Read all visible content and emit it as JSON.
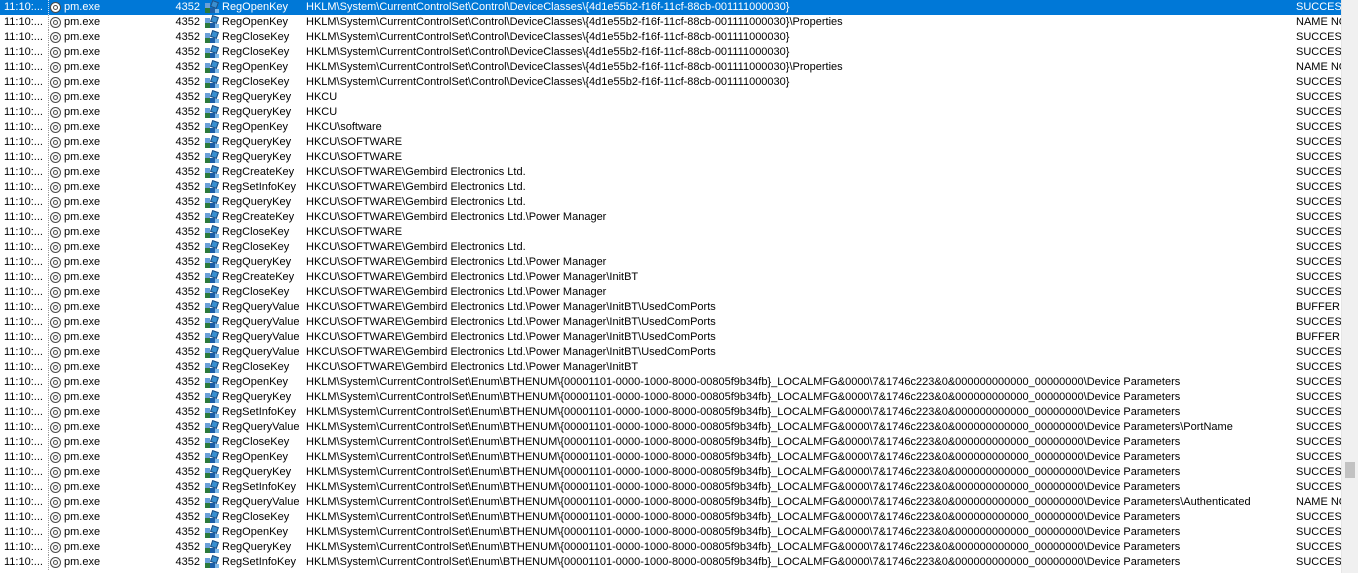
{
  "events": [
    {
      "time": "11:10:...",
      "process": "pm.exe",
      "pid": "4352",
      "operation": "RegOpenKey",
      "path": "HKLM\\System\\CurrentControlSet\\Control\\DeviceClasses\\{4d1e55b2-f16f-11cf-88cb-001111000030}",
      "result": "SUCCESS",
      "selected": true
    },
    {
      "time": "11:10:...",
      "process": "pm.exe",
      "pid": "4352",
      "operation": "RegOpenKey",
      "path": "HKLM\\System\\CurrentControlSet\\Control\\DeviceClasses\\{4d1e55b2-f16f-11cf-88cb-001111000030}\\Properties",
      "result": "NAME NOT FOUND"
    },
    {
      "time": "11:10:...",
      "process": "pm.exe",
      "pid": "4352",
      "operation": "RegCloseKey",
      "path": "HKLM\\System\\CurrentControlSet\\Control\\DeviceClasses\\{4d1e55b2-f16f-11cf-88cb-001111000030}",
      "result": "SUCCESS"
    },
    {
      "time": "11:10:...",
      "process": "pm.exe",
      "pid": "4352",
      "operation": "RegCloseKey",
      "path": "HKLM\\System\\CurrentControlSet\\Control\\DeviceClasses\\{4d1e55b2-f16f-11cf-88cb-001111000030}",
      "result": "SUCCESS"
    },
    {
      "time": "11:10:...",
      "process": "pm.exe",
      "pid": "4352",
      "operation": "RegOpenKey",
      "path": "HKLM\\System\\CurrentControlSet\\Control\\DeviceClasses\\{4d1e55b2-f16f-11cf-88cb-001111000030}\\Properties",
      "result": "NAME NOT FOUND"
    },
    {
      "time": "11:10:...",
      "process": "pm.exe",
      "pid": "4352",
      "operation": "RegCloseKey",
      "path": "HKLM\\System\\CurrentControlSet\\Control\\DeviceClasses\\{4d1e55b2-f16f-11cf-88cb-001111000030}",
      "result": "SUCCESS"
    },
    {
      "time": "11:10:...",
      "process": "pm.exe",
      "pid": "4352",
      "operation": "RegQueryKey",
      "path": "HKCU",
      "result": "SUCCESS"
    },
    {
      "time": "11:10:...",
      "process": "pm.exe",
      "pid": "4352",
      "operation": "RegQueryKey",
      "path": "HKCU",
      "result": "SUCCESS"
    },
    {
      "time": "11:10:...",
      "process": "pm.exe",
      "pid": "4352",
      "operation": "RegOpenKey",
      "path": "HKCU\\software",
      "result": "SUCCESS"
    },
    {
      "time": "11:10:...",
      "process": "pm.exe",
      "pid": "4352",
      "operation": "RegQueryKey",
      "path": "HKCU\\SOFTWARE",
      "result": "SUCCESS"
    },
    {
      "time": "11:10:...",
      "process": "pm.exe",
      "pid": "4352",
      "operation": "RegQueryKey",
      "path": "HKCU\\SOFTWARE",
      "result": "SUCCESS"
    },
    {
      "time": "11:10:...",
      "process": "pm.exe",
      "pid": "4352",
      "operation": "RegCreateKey",
      "path": "HKCU\\SOFTWARE\\Gembird Electronics Ltd.",
      "result": "SUCCESS"
    },
    {
      "time": "11:10:...",
      "process": "pm.exe",
      "pid": "4352",
      "operation": "RegSetInfoKey",
      "path": "HKCU\\SOFTWARE\\Gembird Electronics Ltd.",
      "result": "SUCCESS"
    },
    {
      "time": "11:10:...",
      "process": "pm.exe",
      "pid": "4352",
      "operation": "RegQueryKey",
      "path": "HKCU\\SOFTWARE\\Gembird Electronics Ltd.",
      "result": "SUCCESS"
    },
    {
      "time": "11:10:...",
      "process": "pm.exe",
      "pid": "4352",
      "operation": "RegCreateKey",
      "path": "HKCU\\SOFTWARE\\Gembird Electronics Ltd.\\Power Manager",
      "result": "SUCCESS"
    },
    {
      "time": "11:10:...",
      "process": "pm.exe",
      "pid": "4352",
      "operation": "RegCloseKey",
      "path": "HKCU\\SOFTWARE",
      "result": "SUCCESS"
    },
    {
      "time": "11:10:...",
      "process": "pm.exe",
      "pid": "4352",
      "operation": "RegCloseKey",
      "path": "HKCU\\SOFTWARE\\Gembird Electronics Ltd.",
      "result": "SUCCESS"
    },
    {
      "time": "11:10:...",
      "process": "pm.exe",
      "pid": "4352",
      "operation": "RegQueryKey",
      "path": "HKCU\\SOFTWARE\\Gembird Electronics Ltd.\\Power Manager",
      "result": "SUCCESS"
    },
    {
      "time": "11:10:...",
      "process": "pm.exe",
      "pid": "4352",
      "operation": "RegCreateKey",
      "path": "HKCU\\SOFTWARE\\Gembird Electronics Ltd.\\Power Manager\\InitBT",
      "result": "SUCCESS"
    },
    {
      "time": "11:10:...",
      "process": "pm.exe",
      "pid": "4352",
      "operation": "RegCloseKey",
      "path": "HKCU\\SOFTWARE\\Gembird Electronics Ltd.\\Power Manager",
      "result": "SUCCESS"
    },
    {
      "time": "11:10:...",
      "process": "pm.exe",
      "pid": "4352",
      "operation": "RegQueryValue",
      "path": "HKCU\\SOFTWARE\\Gembird Electronics Ltd.\\Power Manager\\InitBT\\UsedComPorts",
      "result": "BUFFER OVERFLOW"
    },
    {
      "time": "11:10:...",
      "process": "pm.exe",
      "pid": "4352",
      "operation": "RegQueryValue",
      "path": "HKCU\\SOFTWARE\\Gembird Electronics Ltd.\\Power Manager\\InitBT\\UsedComPorts",
      "result": "SUCCESS"
    },
    {
      "time": "11:10:...",
      "process": "pm.exe",
      "pid": "4352",
      "operation": "RegQueryValue",
      "path": "HKCU\\SOFTWARE\\Gembird Electronics Ltd.\\Power Manager\\InitBT\\UsedComPorts",
      "result": "BUFFER OVERFLOW"
    },
    {
      "time": "11:10:...",
      "process": "pm.exe",
      "pid": "4352",
      "operation": "RegQueryValue",
      "path": "HKCU\\SOFTWARE\\Gembird Electronics Ltd.\\Power Manager\\InitBT\\UsedComPorts",
      "result": "SUCCESS"
    },
    {
      "time": "11:10:...",
      "process": "pm.exe",
      "pid": "4352",
      "operation": "RegCloseKey",
      "path": "HKCU\\SOFTWARE\\Gembird Electronics Ltd.\\Power Manager\\InitBT",
      "result": "SUCCESS"
    },
    {
      "time": "11:10:...",
      "process": "pm.exe",
      "pid": "4352",
      "operation": "RegOpenKey",
      "path": "HKLM\\System\\CurrentControlSet\\Enum\\BTHENUM\\{00001101-0000-1000-8000-00805f9b34fb}_LOCALMFG&0000\\7&1746c223&0&000000000000_00000000\\Device Parameters",
      "result": "SUCCESS"
    },
    {
      "time": "11:10:...",
      "process": "pm.exe",
      "pid": "4352",
      "operation": "RegQueryKey",
      "path": "HKLM\\System\\CurrentControlSet\\Enum\\BTHENUM\\{00001101-0000-1000-8000-00805f9b34fb}_LOCALMFG&0000\\7&1746c223&0&000000000000_00000000\\Device Parameters",
      "result": "SUCCESS"
    },
    {
      "time": "11:10:...",
      "process": "pm.exe",
      "pid": "4352",
      "operation": "RegSetInfoKey",
      "path": "HKLM\\System\\CurrentControlSet\\Enum\\BTHENUM\\{00001101-0000-1000-8000-00805f9b34fb}_LOCALMFG&0000\\7&1746c223&0&000000000000_00000000\\Device Parameters",
      "result": "SUCCESS"
    },
    {
      "time": "11:10:...",
      "process": "pm.exe",
      "pid": "4352",
      "operation": "RegQueryValue",
      "path": "HKLM\\System\\CurrentControlSet\\Enum\\BTHENUM\\{00001101-0000-1000-8000-00805f9b34fb}_LOCALMFG&0000\\7&1746c223&0&000000000000_00000000\\Device Parameters\\PortName",
      "result": "SUCCESS"
    },
    {
      "time": "11:10:...",
      "process": "pm.exe",
      "pid": "4352",
      "operation": "RegCloseKey",
      "path": "HKLM\\System\\CurrentControlSet\\Enum\\BTHENUM\\{00001101-0000-1000-8000-00805f9b34fb}_LOCALMFG&0000\\7&1746c223&0&000000000000_00000000\\Device Parameters",
      "result": "SUCCESS"
    },
    {
      "time": "11:10:...",
      "process": "pm.exe",
      "pid": "4352",
      "operation": "RegOpenKey",
      "path": "HKLM\\System\\CurrentControlSet\\Enum\\BTHENUM\\{00001101-0000-1000-8000-00805f9b34fb}_LOCALMFG&0000\\7&1746c223&0&000000000000_00000000\\Device Parameters",
      "result": "SUCCESS"
    },
    {
      "time": "11:10:...",
      "process": "pm.exe",
      "pid": "4352",
      "operation": "RegQueryKey",
      "path": "HKLM\\System\\CurrentControlSet\\Enum\\BTHENUM\\{00001101-0000-1000-8000-00805f9b34fb}_LOCALMFG&0000\\7&1746c223&0&000000000000_00000000\\Device Parameters",
      "result": "SUCCESS"
    },
    {
      "time": "11:10:...",
      "process": "pm.exe",
      "pid": "4352",
      "operation": "RegSetInfoKey",
      "path": "HKLM\\System\\CurrentControlSet\\Enum\\BTHENUM\\{00001101-0000-1000-8000-00805f9b34fb}_LOCALMFG&0000\\7&1746c223&0&000000000000_00000000\\Device Parameters",
      "result": "SUCCESS"
    },
    {
      "time": "11:10:...",
      "process": "pm.exe",
      "pid": "4352",
      "operation": "RegQueryValue",
      "path": "HKLM\\System\\CurrentControlSet\\Enum\\BTHENUM\\{00001101-0000-1000-8000-00805f9b34fb}_LOCALMFG&0000\\7&1746c223&0&000000000000_00000000\\Device Parameters\\Authenticated",
      "result": "NAME NOT FOUND"
    },
    {
      "time": "11:10:...",
      "process": "pm.exe",
      "pid": "4352",
      "operation": "RegCloseKey",
      "path": "HKLM\\System\\CurrentControlSet\\Enum\\BTHENUM\\{00001101-0000-1000-8000-00805f9b34fb}_LOCALMFG&0000\\7&1746c223&0&000000000000_00000000\\Device Parameters",
      "result": "SUCCESS"
    },
    {
      "time": "11:10:...",
      "process": "pm.exe",
      "pid": "4352",
      "operation": "RegOpenKey",
      "path": "HKLM\\System\\CurrentControlSet\\Enum\\BTHENUM\\{00001101-0000-1000-8000-00805f9b34fb}_LOCALMFG&0000\\7&1746c223&0&000000000000_00000000\\Device Parameters",
      "result": "SUCCESS"
    },
    {
      "time": "11:10:...",
      "process": "pm.exe",
      "pid": "4352",
      "operation": "RegQueryKey",
      "path": "HKLM\\System\\CurrentControlSet\\Enum\\BTHENUM\\{00001101-0000-1000-8000-00805f9b34fb}_LOCALMFG&0000\\7&1746c223&0&000000000000_00000000\\Device Parameters",
      "result": "SUCCESS"
    },
    {
      "time": "11:10:...",
      "process": "pm.exe",
      "pid": "4352",
      "operation": "RegSetInfoKey",
      "path": "HKLM\\System\\CurrentControlSet\\Enum\\BTHENUM\\{00001101-0000-1000-8000-00805f9b34fb}_LOCALMFG&0000\\7&1746c223&0&000000000000_00000000\\Device Parameters",
      "result": "SUCCESS"
    }
  ],
  "colors": {
    "selection": "#0078d7",
    "text": "#000000",
    "background": "#ffffff"
  },
  "icons": {
    "process": "process-icon",
    "operation": "registry-icon"
  }
}
